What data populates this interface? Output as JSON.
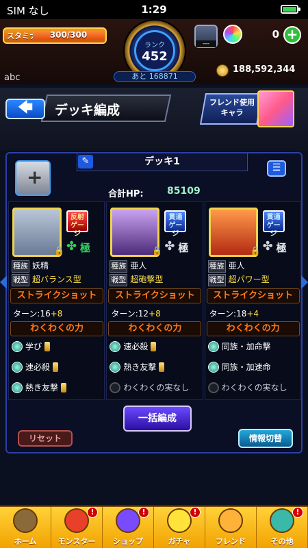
{
  "status_bar": {
    "carrier": "SIM なし",
    "time": "1:29",
    "battery_level": 0.9
  },
  "hud": {
    "stamina_label": "スタミナ",
    "stamina_text": "300/300",
    "stamina_fraction": 1.0,
    "rank_label": "ランク",
    "rank_value": "452",
    "rank_next": "あと 168871",
    "orb_count": "0",
    "coin_value": "188,592,344"
  },
  "username": "abc",
  "header": {
    "back_icon": "🡄",
    "title": "デッキ編成",
    "friend_label_line1": "フレンド使用",
    "friend_label_line2": "キャラ"
  },
  "deck": {
    "name": "デッキ1",
    "hp_label": "合計HP:",
    "hp_value": "85109",
    "cards": [
      {
        "badge_line1": "反射",
        "badge_line2": "ゲージ",
        "badge_color": "red",
        "kyoku": "極",
        "kyoku_color": "green",
        "race_label": "種族",
        "race": "妖精",
        "type_label": "戦型",
        "type": "超バランス型",
        "strike_shot": "ストライクショット",
        "turn_text": "ターン:16",
        "turn_plus": "+8",
        "waku": "わくわくの力",
        "abilities": [
          {
            "text": "学び",
            "potion": true,
            "icon": "teal"
          },
          {
            "text": "速必殺",
            "potion": true,
            "icon": "teal"
          },
          {
            "text": "熱き友撃",
            "potion": true,
            "icon": "teal"
          }
        ]
      },
      {
        "badge_line1": "貫通",
        "badge_line2": "ゲージ",
        "badge_color": "blue",
        "kyoku": "極",
        "kyoku_color": "gray",
        "race_label": "種族",
        "race": "亜人",
        "type_label": "戦型",
        "type": "超砲撃型",
        "strike_shot": "ストライクショット",
        "turn_text": "ターン:12",
        "turn_plus": "+8",
        "waku": "わくわくの力",
        "abilities": [
          {
            "text": "速必殺",
            "potion": true,
            "icon": "teal"
          },
          {
            "text": "熱き友撃",
            "potion": true,
            "icon": "teal"
          },
          {
            "text": "わくわくの実なし",
            "potion": false,
            "icon": "empty"
          }
        ]
      },
      {
        "badge_line1": "貫通",
        "badge_line2": "ゲージ",
        "badge_color": "blue",
        "kyoku": "極",
        "kyoku_color": "gray",
        "race_label": "種族",
        "race": "亜人",
        "type_label": "戦型",
        "type": "超パワー型",
        "strike_shot": "ストライクショット",
        "turn_text": "ターン:18",
        "turn_plus": "+4",
        "waku": "わくわくの力",
        "abilities": [
          {
            "text": "同族・加命撃",
            "potion": false,
            "icon": "teal"
          },
          {
            "text": "同族・加速命",
            "potion": false,
            "icon": "teal"
          },
          {
            "text": "わくわくの実なし",
            "potion": false,
            "icon": "empty"
          }
        ]
      }
    ],
    "bulk_button": "一括編成",
    "reset_button": "リセット",
    "info_button": "情報切替"
  },
  "nav": {
    "items": [
      {
        "label": "ホーム",
        "color": "#8a6a3a",
        "notice": false
      },
      {
        "label": "モンスター",
        "color": "#e8402a",
        "notice": true
      },
      {
        "label": "ショップ",
        "color": "#7a4aff",
        "notice": true
      },
      {
        "label": "ガチャ",
        "color": "#ffe23a",
        "notice": true
      },
      {
        "label": "フレンド",
        "color": "#ffb23a",
        "notice": false
      },
      {
        "label": "その他",
        "color": "#3ab8a8",
        "notice": true
      }
    ],
    "notice_text": "!"
  }
}
